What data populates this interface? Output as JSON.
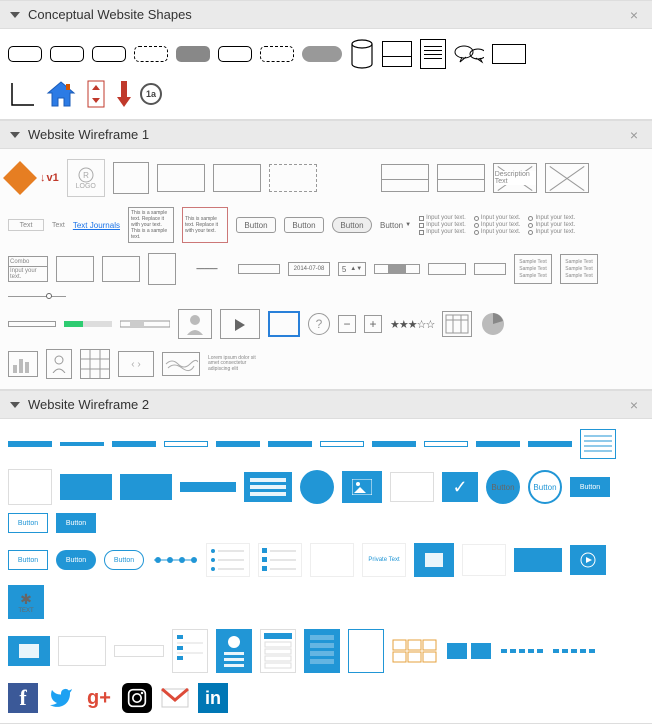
{
  "sections": {
    "s1": {
      "title": "Conceptual Website Shapes"
    },
    "s2": {
      "title": "Website Wireframe 1"
    },
    "s3": {
      "title": "Website Wireframe 2"
    }
  },
  "conceptual": {
    "step_label": "1a"
  },
  "wf1": {
    "logo_text": "LOGO",
    "v1_label": "v1",
    "text_label": "Text",
    "link_label": "Text Journals",
    "desc_text": "Description Text",
    "para1": "This is a sample text. Replace it with your text.",
    "para2": "This is a sample text. Replace it with your text. This is a sample text.",
    "para3": "This is sample text. Replace it with your text.",
    "button_label": "Button",
    "input_label": "Input your text.",
    "combo_label": "Combo",
    "date_value": "2014-07-08",
    "spinner_value": "5",
    "sample_text": "Sample Text",
    "help_symbol": "?",
    "minus_symbol": "−",
    "plus_symbol": "+",
    "stars": "★★★☆☆",
    "lorem": "Lorem ipsum dolor sit amet consectetur adipiscing elit"
  },
  "wf2": {
    "button_label": "Button",
    "private_text": "Private Text",
    "text_label": "TEXT"
  },
  "social": {
    "fb": "f",
    "tw": "🐦",
    "gp": "g+",
    "ig": "◉",
    "gm": "M",
    "li": "in"
  }
}
